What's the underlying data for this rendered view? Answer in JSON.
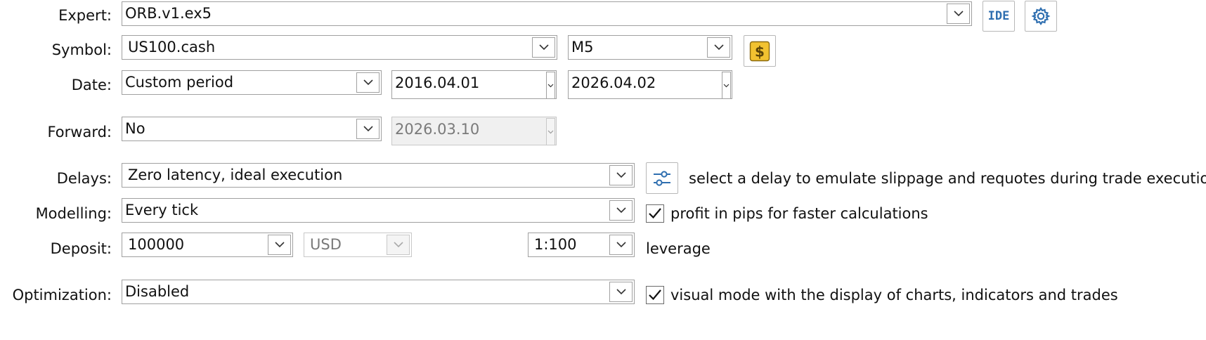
{
  "labels": {
    "expert": "Expert:",
    "symbol": "Symbol:",
    "date": "Date:",
    "forward": "Forward:",
    "delays": "Delays:",
    "modelling": "Modelling:",
    "deposit": "Deposit:",
    "optimization": "Optimization:"
  },
  "expert": {
    "value": "ORB.v1.ex5",
    "ide_label": "IDE",
    "settings_icon": "gear-icon"
  },
  "symbol": {
    "value": "US100.cash",
    "timeframe": "M5",
    "symbol_icon": "dollar-icon"
  },
  "date": {
    "period": "Custom period",
    "from": "2016.04.01",
    "to": "2026.04.02"
  },
  "forward": {
    "value": "No",
    "date": "2026.03.10"
  },
  "delays": {
    "value": "Zero latency, ideal execution",
    "note": "select a delay to emulate slippage and requotes during trade execution",
    "icon": "sliders-icon"
  },
  "modelling": {
    "value": "Every tick",
    "checkbox_checked": true,
    "checkbox_label": "profit in pips for faster calculations"
  },
  "deposit": {
    "value": "100000",
    "currency": "USD",
    "leverage": "1:100",
    "leverage_label": "leverage"
  },
  "optimization": {
    "value": "Disabled",
    "checkbox_checked": true,
    "checkbox_label": "visual mode with the display of charts, indicators and trades"
  },
  "colors": {
    "accent_blue": "#2f6fb0",
    "dollar_yellow": "#f2c230"
  }
}
